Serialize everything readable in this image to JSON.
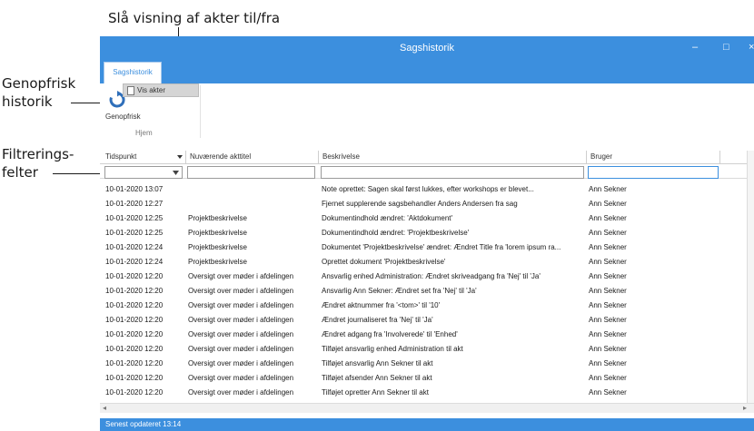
{
  "callouts": {
    "top": "Slå visning af akter til/fra",
    "refresh": [
      "Genopfrisk",
      "historik"
    ],
    "filter": [
      "Filtrerings-",
      "felter"
    ]
  },
  "window": {
    "title": "Sagshistorik",
    "minimize_glyph": "–",
    "maximize_glyph": "□",
    "close_glyph": "×"
  },
  "ribbon": {
    "tab_label": "Sagshistorik",
    "refresh_label": "Genopfrisk",
    "vis_akter_label": "Vis akter",
    "group_label": "Hjem"
  },
  "grid": {
    "columns": [
      "Tidspunkt",
      "Nuværende akttitel",
      "Beskrivelse",
      "Bruger"
    ],
    "rows": [
      {
        "time": "10-01-2020 13:07",
        "title": "",
        "desc": "Note oprettet: Sagen skal først lukkes, efter workshops er blevet...",
        "user": "Ann Sekner"
      },
      {
        "time": "10-01-2020 12:27",
        "title": "",
        "desc": "Fjernet supplerende sagsbehandler Anders Andersen fra sag",
        "user": "Ann Sekner"
      },
      {
        "time": "10-01-2020 12:25",
        "title": "Projektbeskrivelse",
        "desc": "Dokumentindhold ændret: 'Aktdokument'",
        "user": "Ann Sekner"
      },
      {
        "time": "10-01-2020 12:25",
        "title": "Projektbeskrivelse",
        "desc": "Dokumentindhold ændret: 'Projektbeskrivelse'",
        "user": "Ann Sekner"
      },
      {
        "time": "10-01-2020 12:24",
        "title": "Projektbeskrivelse",
        "desc": "Dokumentet 'Projektbeskrivelse' ændret: Ændret Title fra 'lorem ipsum ra...",
        "user": "Ann Sekner"
      },
      {
        "time": "10-01-2020 12:24",
        "title": "Projektbeskrivelse",
        "desc": "Oprettet dokument 'Projektbeskrivelse'",
        "user": "Ann Sekner"
      },
      {
        "time": "10-01-2020 12:20",
        "title": "Oversigt over møder i afdelingen",
        "desc": "Ansvarlig enhed Administration: Ændret skriveadgang fra 'Nej' til 'Ja'",
        "user": "Ann Sekner"
      },
      {
        "time": "10-01-2020 12:20",
        "title": "Oversigt over møder i afdelingen",
        "desc": "Ansvarlig Ann Sekner: Ændret set fra 'Nej' til 'Ja'",
        "user": "Ann Sekner"
      },
      {
        "time": "10-01-2020 12:20",
        "title": "Oversigt over møder i afdelingen",
        "desc": "Ændret aktnummer fra '<tom>' til '10'",
        "user": "Ann Sekner"
      },
      {
        "time": "10-01-2020 12:20",
        "title": "Oversigt over møder i afdelingen",
        "desc": "Ændret journaliseret fra 'Nej' til 'Ja'",
        "user": "Ann Sekner"
      },
      {
        "time": "10-01-2020 12:20",
        "title": "Oversigt over møder i afdelingen",
        "desc": "Ændret adgang fra 'Involverede' til 'Enhed'",
        "user": "Ann Sekner"
      },
      {
        "time": "10-01-2020 12:20",
        "title": "Oversigt over møder i afdelingen",
        "desc": "Tilføjet ansvarlig enhed Administration til akt",
        "user": "Ann Sekner"
      },
      {
        "time": "10-01-2020 12:20",
        "title": "Oversigt over møder i afdelingen",
        "desc": "Tilføjet ansvarlig Ann Sekner til akt",
        "user": "Ann Sekner"
      },
      {
        "time": "10-01-2020 12:20",
        "title": "Oversigt over møder i afdelingen",
        "desc": "Tilføjet afsender Ann Sekner til akt",
        "user": "Ann Sekner"
      },
      {
        "time": "10-01-2020 12:20",
        "title": "Oversigt over møder i afdelingen",
        "desc": "Tilføjet opretter Ann Sekner til akt",
        "user": "Ann Sekner"
      }
    ]
  },
  "status": "Senest opdateret 13:14",
  "colors": {
    "accent": "#3c8fde",
    "refresh_icon": "#2f6fba"
  },
  "icons": {
    "refresh": "refresh-icon",
    "document": "document-icon",
    "dropdown": "chevron-down-icon"
  }
}
